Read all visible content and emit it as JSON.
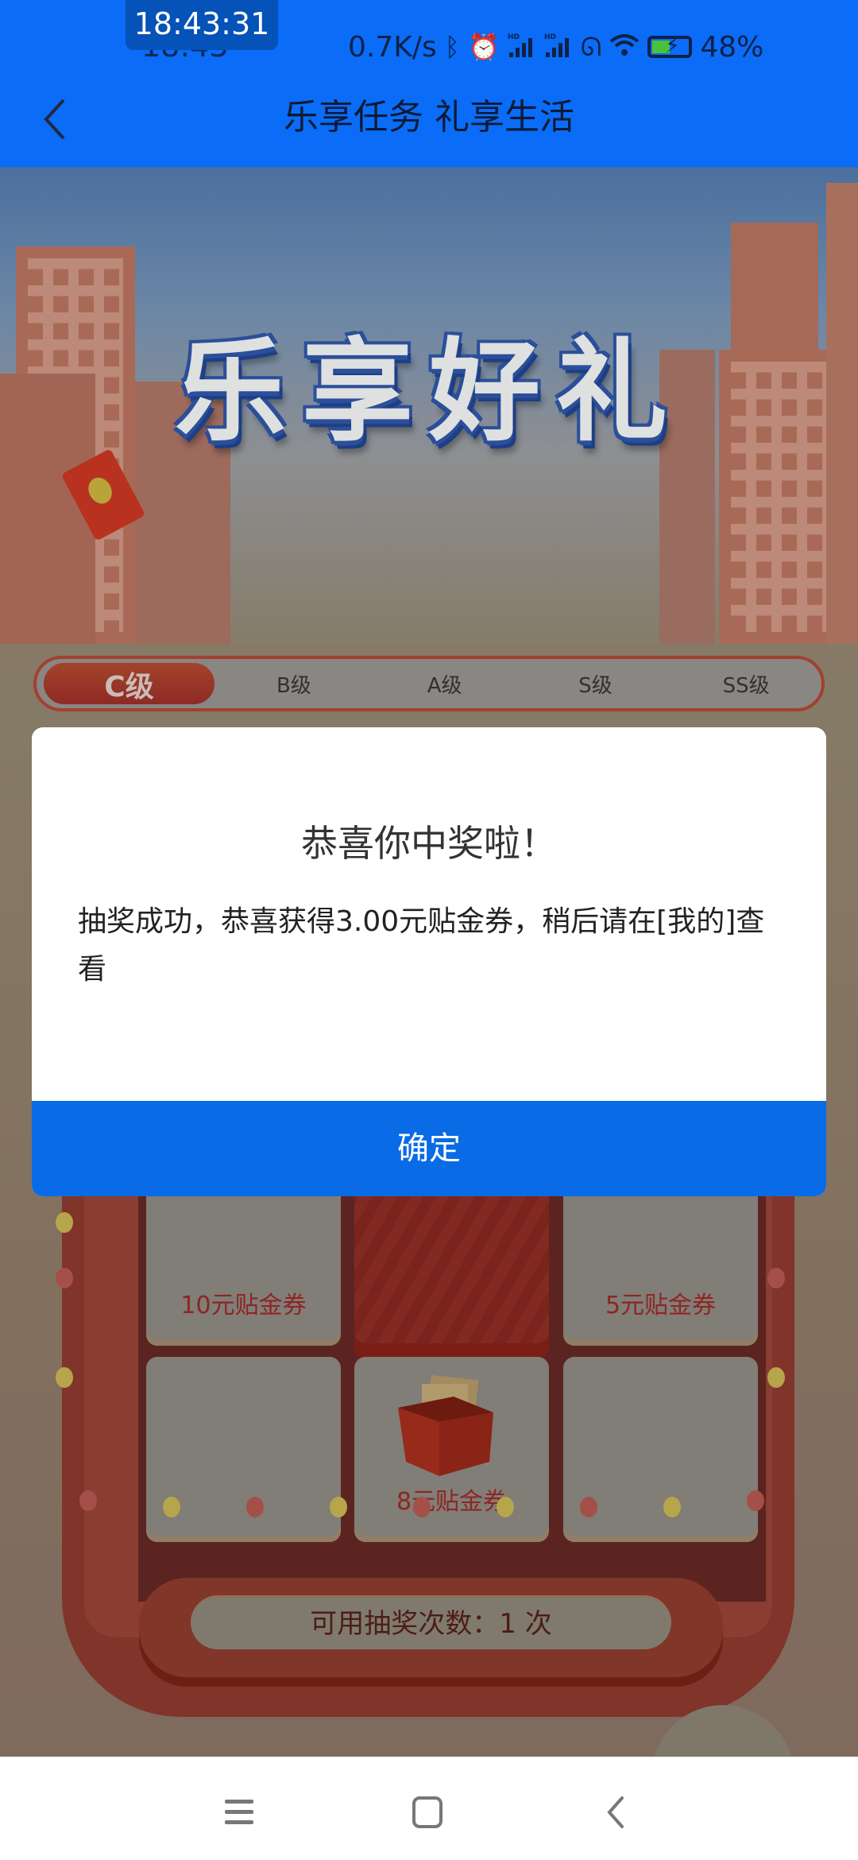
{
  "status_bar": {
    "clock_badge": "18:43:31",
    "time": "18:43",
    "net_speed": "0.7K/s",
    "icons": [
      "bluetooth-icon",
      "alarm-icon",
      "signal-hd-icon",
      "signal-hd-icon",
      "link-icon",
      "wifi-icon",
      "battery-charging-icon"
    ],
    "battery": "48%",
    "battery_level": 0.48
  },
  "header": {
    "title": "乐享任务 礼享生活",
    "back_icon": "chevron-left-icon"
  },
  "banner": {
    "title": "乐享好礼"
  },
  "levels": {
    "tabs": [
      {
        "label": "C级",
        "active": true
      },
      {
        "label": "B级",
        "active": false
      },
      {
        "label": "A级",
        "active": false
      },
      {
        "label": "S级",
        "active": false
      },
      {
        "label": "SS级",
        "active": false
      }
    ]
  },
  "prize_grid": {
    "cells": [
      {
        "label": "10元贴金券"
      },
      {
        "label": ""
      },
      {
        "label": "5元贴金券"
      },
      {
        "label": ""
      },
      {
        "label": "8元贴金券",
        "icon": "voucher-box-icon"
      },
      {
        "label": ""
      }
    ]
  },
  "counter": {
    "text": "可用抽奖次数：1 次"
  },
  "dialog": {
    "title": "恭喜你中奖啦！",
    "message": "抽奖成功，恭喜获得3.00元贴金券，稍后请在[我的]查看",
    "confirm_label": "确定"
  },
  "nav_bar": {
    "buttons": [
      "menu-icon",
      "home-icon",
      "back-icon"
    ]
  },
  "colors": {
    "header_blue": "#0a6cf7",
    "dialog_button": "#096be6",
    "prize_text": "#8e2522"
  }
}
